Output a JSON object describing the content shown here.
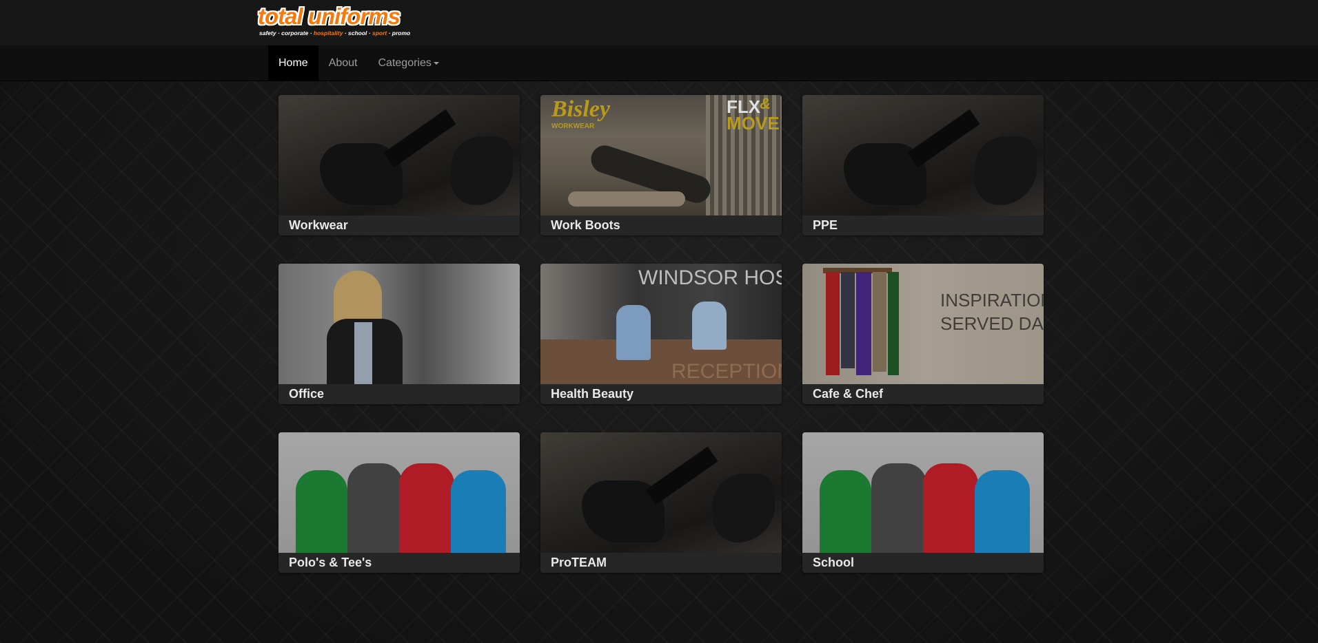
{
  "brand": {
    "logo_text": "total uniforms",
    "tagline": [
      "safety",
      "corporate",
      "hospitality",
      "school",
      "sport",
      "promo"
    ],
    "accent_color": "#f47a10"
  },
  "nav": {
    "items": [
      {
        "label": "Home",
        "active": true
      },
      {
        "label": "About",
        "active": false
      },
      {
        "label": "Categories",
        "active": false,
        "dropdown": true
      }
    ]
  },
  "categories": [
    {
      "label": "Workwear",
      "image": "gloved-hands-wrench"
    },
    {
      "label": "Work Boots",
      "image": "bisley-flx-move-worker",
      "image_text": [
        "Bisley",
        "WORKWEAR",
        "FLX",
        "&",
        "MOVE"
      ]
    },
    {
      "label": "PPE",
      "image": "gloved-hands-wrench"
    },
    {
      "label": "Office",
      "image": "woman-in-blazer"
    },
    {
      "label": "Health Beauty",
      "image": "hospital-reception",
      "image_text": [
        "WINDSOR HOSPITAL",
        "RECEPTION"
      ]
    },
    {
      "label": "Cafe & Chef",
      "image": "hanging-aprons",
      "image_text": [
        "INSPIRATION",
        "SERVED DAILY"
      ]
    },
    {
      "label": "Polo's & Tee's",
      "image": "four-people-polos"
    },
    {
      "label": "ProTEAM",
      "image": "gloved-hands-wrench"
    },
    {
      "label": "School",
      "image": "four-people-polos"
    }
  ]
}
